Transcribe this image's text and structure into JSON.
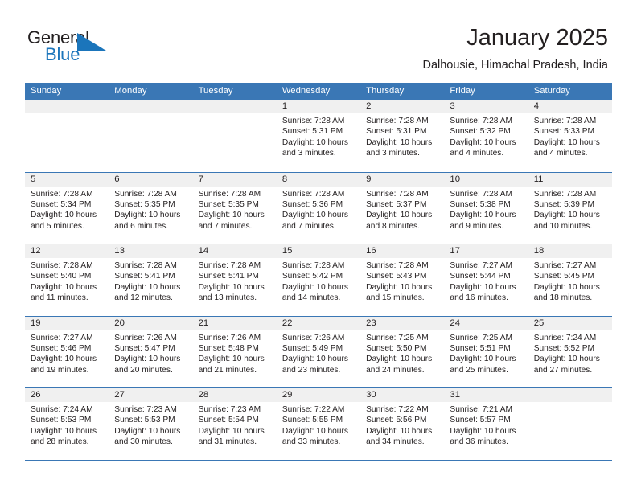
{
  "brand": {
    "name_part1": "General",
    "name_part2": "Blue",
    "accent_color": "#1b75bb",
    "logo_icon": "triangle-flag-icon"
  },
  "header": {
    "title": "January 2025",
    "subtitle": "Dalhousie, Himachal Pradesh, India"
  },
  "theme": {
    "header_row_color": "#3a77b5",
    "date_band_color": "#f0f0f0",
    "grid_line_color": "#3a77b5",
    "text_color": "#231f20"
  },
  "calendar": {
    "weekday_headers": [
      "Sunday",
      "Monday",
      "Tuesday",
      "Wednesday",
      "Thursday",
      "Friday",
      "Saturday"
    ],
    "weeks": [
      [
        {
          "day": "",
          "lines": []
        },
        {
          "day": "",
          "lines": []
        },
        {
          "day": "",
          "lines": []
        },
        {
          "day": "1",
          "lines": [
            "Sunrise: 7:28 AM",
            "Sunset: 5:31 PM",
            "Daylight: 10 hours",
            "and 3 minutes."
          ]
        },
        {
          "day": "2",
          "lines": [
            "Sunrise: 7:28 AM",
            "Sunset: 5:31 PM",
            "Daylight: 10 hours",
            "and 3 minutes."
          ]
        },
        {
          "day": "3",
          "lines": [
            "Sunrise: 7:28 AM",
            "Sunset: 5:32 PM",
            "Daylight: 10 hours",
            "and 4 minutes."
          ]
        },
        {
          "day": "4",
          "lines": [
            "Sunrise: 7:28 AM",
            "Sunset: 5:33 PM",
            "Daylight: 10 hours",
            "and 4 minutes."
          ]
        }
      ],
      [
        {
          "day": "5",
          "lines": [
            "Sunrise: 7:28 AM",
            "Sunset: 5:34 PM",
            "Daylight: 10 hours",
            "and 5 minutes."
          ]
        },
        {
          "day": "6",
          "lines": [
            "Sunrise: 7:28 AM",
            "Sunset: 5:35 PM",
            "Daylight: 10 hours",
            "and 6 minutes."
          ]
        },
        {
          "day": "7",
          "lines": [
            "Sunrise: 7:28 AM",
            "Sunset: 5:35 PM",
            "Daylight: 10 hours",
            "and 7 minutes."
          ]
        },
        {
          "day": "8",
          "lines": [
            "Sunrise: 7:28 AM",
            "Sunset: 5:36 PM",
            "Daylight: 10 hours",
            "and 7 minutes."
          ]
        },
        {
          "day": "9",
          "lines": [
            "Sunrise: 7:28 AM",
            "Sunset: 5:37 PM",
            "Daylight: 10 hours",
            "and 8 minutes."
          ]
        },
        {
          "day": "10",
          "lines": [
            "Sunrise: 7:28 AM",
            "Sunset: 5:38 PM",
            "Daylight: 10 hours",
            "and 9 minutes."
          ]
        },
        {
          "day": "11",
          "lines": [
            "Sunrise: 7:28 AM",
            "Sunset: 5:39 PM",
            "Daylight: 10 hours",
            "and 10 minutes."
          ]
        }
      ],
      [
        {
          "day": "12",
          "lines": [
            "Sunrise: 7:28 AM",
            "Sunset: 5:40 PM",
            "Daylight: 10 hours",
            "and 11 minutes."
          ]
        },
        {
          "day": "13",
          "lines": [
            "Sunrise: 7:28 AM",
            "Sunset: 5:41 PM",
            "Daylight: 10 hours",
            "and 12 minutes."
          ]
        },
        {
          "day": "14",
          "lines": [
            "Sunrise: 7:28 AM",
            "Sunset: 5:41 PM",
            "Daylight: 10 hours",
            "and 13 minutes."
          ]
        },
        {
          "day": "15",
          "lines": [
            "Sunrise: 7:28 AM",
            "Sunset: 5:42 PM",
            "Daylight: 10 hours",
            "and 14 minutes."
          ]
        },
        {
          "day": "16",
          "lines": [
            "Sunrise: 7:28 AM",
            "Sunset: 5:43 PM",
            "Daylight: 10 hours",
            "and 15 minutes."
          ]
        },
        {
          "day": "17",
          "lines": [
            "Sunrise: 7:27 AM",
            "Sunset: 5:44 PM",
            "Daylight: 10 hours",
            "and 16 minutes."
          ]
        },
        {
          "day": "18",
          "lines": [
            "Sunrise: 7:27 AM",
            "Sunset: 5:45 PM",
            "Daylight: 10 hours",
            "and 18 minutes."
          ]
        }
      ],
      [
        {
          "day": "19",
          "lines": [
            "Sunrise: 7:27 AM",
            "Sunset: 5:46 PM",
            "Daylight: 10 hours",
            "and 19 minutes."
          ]
        },
        {
          "day": "20",
          "lines": [
            "Sunrise: 7:26 AM",
            "Sunset: 5:47 PM",
            "Daylight: 10 hours",
            "and 20 minutes."
          ]
        },
        {
          "day": "21",
          "lines": [
            "Sunrise: 7:26 AM",
            "Sunset: 5:48 PM",
            "Daylight: 10 hours",
            "and 21 minutes."
          ]
        },
        {
          "day": "22",
          "lines": [
            "Sunrise: 7:26 AM",
            "Sunset: 5:49 PM",
            "Daylight: 10 hours",
            "and 23 minutes."
          ]
        },
        {
          "day": "23",
          "lines": [
            "Sunrise: 7:25 AM",
            "Sunset: 5:50 PM",
            "Daylight: 10 hours",
            "and 24 minutes."
          ]
        },
        {
          "day": "24",
          "lines": [
            "Sunrise: 7:25 AM",
            "Sunset: 5:51 PM",
            "Daylight: 10 hours",
            "and 25 minutes."
          ]
        },
        {
          "day": "25",
          "lines": [
            "Sunrise: 7:24 AM",
            "Sunset: 5:52 PM",
            "Daylight: 10 hours",
            "and 27 minutes."
          ]
        }
      ],
      [
        {
          "day": "26",
          "lines": [
            "Sunrise: 7:24 AM",
            "Sunset: 5:53 PM",
            "Daylight: 10 hours",
            "and 28 minutes."
          ]
        },
        {
          "day": "27",
          "lines": [
            "Sunrise: 7:23 AM",
            "Sunset: 5:53 PM",
            "Daylight: 10 hours",
            "and 30 minutes."
          ]
        },
        {
          "day": "28",
          "lines": [
            "Sunrise: 7:23 AM",
            "Sunset: 5:54 PM",
            "Daylight: 10 hours",
            "and 31 minutes."
          ]
        },
        {
          "day": "29",
          "lines": [
            "Sunrise: 7:22 AM",
            "Sunset: 5:55 PM",
            "Daylight: 10 hours",
            "and 33 minutes."
          ]
        },
        {
          "day": "30",
          "lines": [
            "Sunrise: 7:22 AM",
            "Sunset: 5:56 PM",
            "Daylight: 10 hours",
            "and 34 minutes."
          ]
        },
        {
          "day": "31",
          "lines": [
            "Sunrise: 7:21 AM",
            "Sunset: 5:57 PM",
            "Daylight: 10 hours",
            "and 36 minutes."
          ]
        },
        {
          "day": "",
          "lines": []
        }
      ]
    ]
  }
}
